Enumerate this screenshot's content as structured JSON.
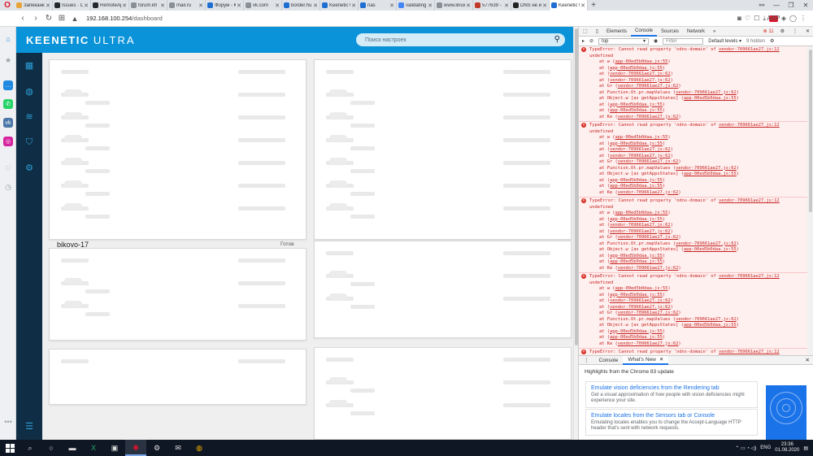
{
  "browser": {
    "logo": "O",
    "new_tab": "+",
    "close_glyph": "✕",
    "tabs": [
      {
        "label": "Запеканка",
        "color": "#e8a33b"
      },
      {
        "label": "Issues · Co",
        "color": "#24292e"
      },
      {
        "label": "RemoteAp",
        "color": "#24292e"
      },
      {
        "label": "forum.kh",
        "color": "#8a8f96"
      },
      {
        "label": "mail.ru",
        "color": "#8a8f96"
      },
      {
        "label": "Форум - К",
        "color": "#1f6fd0"
      },
      {
        "label": "vk.com",
        "color": "#8a8f96"
      },
      {
        "label": "border.hu",
        "color": "#1f6fd0"
      },
      {
        "label": "Keenetic U",
        "color": "#1f6fd0"
      },
      {
        "label": "nas",
        "color": "#1f6fd0"
      },
      {
        "label": "validating",
        "color": "#4285f4"
      },
      {
        "label": "www.linux",
        "color": "#8a8f96"
      },
      {
        "label": "577639 -",
        "color": "#c0392b"
      },
      {
        "label": "DNS не ис",
        "color": "#222222"
      },
      {
        "label": "Keenetic U",
        "color": "#1f6fd0",
        "active": true
      }
    ],
    "window_controls": [
      "⚯",
      "—",
      "❐",
      "✕"
    ],
    "url_host": "192.168.100.254",
    "url_path": "/dashboard",
    "sidebar_icons": [
      {
        "glyph": "⌂",
        "color": "#1f8ae0"
      },
      {
        "glyph": "★",
        "color": "#9aa0a6"
      },
      {
        "glyph": "…",
        "color": "#1f8ae0"
      },
      {
        "glyph": "✆",
        "color": "#25d366"
      },
      {
        "glyph": "vk",
        "color": "#4a76a8"
      },
      {
        "glyph": "◎",
        "color": "#d6249f"
      },
      {
        "glyph": "♡",
        "color": "#9aa0a6"
      },
      {
        "glyph": "◷",
        "color": "#9aa0a6"
      },
      {
        "glyph": "•••",
        "color": "#9aa0a6"
      }
    ]
  },
  "app": {
    "logo_main": "KEENETIC",
    "logo_sub": "ULTRA",
    "search_placeholder": "Поиск настроек",
    "node_name": "bikovo-17",
    "node_status": "Готов",
    "accent_color": "#0a93d8",
    "nav_bg": "#0f2e45"
  },
  "devtools": {
    "tabs": [
      "Elements",
      "Console",
      "Sources",
      "Network"
    ],
    "active_tab": "Console",
    "more_tabs": "»",
    "error_count": "11",
    "context": "top",
    "filter_placeholder": "Filter",
    "levels": "Default levels ▾",
    "hidden": "9 hidden",
    "errors": [
      {
        "message": "TypeError: Cannot read property 'ndns-domain' of",
        "source": "vendor-709661ae27.js:12",
        "message2": "undefined",
        "stack": [
          {
            "fn": "at w",
            "loc": "app-00ed5b0daa.js:55"
          },
          {
            "fn": "at",
            "loc": "app-00ed5b0daa.js:55"
          },
          {
            "fn": "at",
            "loc": "vendor-709661ae27.js:62"
          },
          {
            "fn": "at",
            "loc": "vendor-709661ae27.js:62"
          },
          {
            "fn": "at Gr",
            "loc": "vendor-709661ae27.js:62"
          },
          {
            "fn": "at Function.Ot.pr.mapValues",
            "loc": "vendor-709661ae27.js:62"
          },
          {
            "fn": "at Object.w [as getAppsStates]",
            "loc": "app-00ed5b0daa.js:55"
          },
          {
            "fn": "at",
            "loc": "app-00ed5b0daa.js:55"
          },
          {
            "fn": "at",
            "loc": "app-00ed5b0daa.js:55"
          },
          {
            "fn": "at Ke",
            "loc": "vendor-709661ae27.js:62"
          }
        ]
      },
      {
        "message": "TypeError: Cannot read property 'ndns-domain' of",
        "source": "vendor-709661ae27.js:12",
        "message2": "undefined",
        "stack": [
          {
            "fn": "at w",
            "loc": "app-00ed5b0daa.js:55"
          },
          {
            "fn": "at",
            "loc": "app-00ed5b0daa.js:55"
          },
          {
            "fn": "at",
            "loc": "vendor-709661ae27.js:62"
          },
          {
            "fn": "at",
            "loc": "vendor-709661ae27.js:62"
          },
          {
            "fn": "at Gr",
            "loc": "vendor-709661ae27.js:62"
          },
          {
            "fn": "at Function.Ot.pr.mapValues",
            "loc": "vendor-709661ae27.js:62"
          },
          {
            "fn": "at Object.w [as getAppsStates]",
            "loc": "app-00ed5b0daa.js:55"
          },
          {
            "fn": "at",
            "loc": "app-00ed5b0daa.js:55"
          },
          {
            "fn": "at",
            "loc": "app-00ed5b0daa.js:55"
          },
          {
            "fn": "at Ke",
            "loc": "vendor-709661ae27.js:62"
          }
        ]
      },
      {
        "message": "TypeError: Cannot read property 'ndns-domain' of",
        "source": "vendor-709661ae27.js:12",
        "message2": "undefined",
        "stack": [
          {
            "fn": "at w",
            "loc": "app-00ed5b0daa.js:55"
          },
          {
            "fn": "at",
            "loc": "app-00ed5b0daa.js:55"
          },
          {
            "fn": "at",
            "loc": "vendor-709661ae27.js:62"
          },
          {
            "fn": "at",
            "loc": "vendor-709661ae27.js:62"
          },
          {
            "fn": "at Gr",
            "loc": "vendor-709661ae27.js:62"
          },
          {
            "fn": "at Function.Ot.pr.mapValues",
            "loc": "vendor-709661ae27.js:62"
          },
          {
            "fn": "at Object.w [as getAppsStates]",
            "loc": "app-00ed5b0daa.js:55"
          },
          {
            "fn": "at",
            "loc": "app-00ed5b0daa.js:55"
          },
          {
            "fn": "at",
            "loc": "app-00ed5b0daa.js:55"
          },
          {
            "fn": "at Ke",
            "loc": "vendor-709661ae27.js:62"
          }
        ]
      },
      {
        "message": "TypeError: Cannot read property 'ndns-domain' of",
        "source": "vendor-709661ae27.js:12",
        "message2": "undefined",
        "stack": [
          {
            "fn": "at w",
            "loc": "app-00ed5b0daa.js:55"
          },
          {
            "fn": "at",
            "loc": "app-00ed5b0daa.js:55"
          },
          {
            "fn": "at",
            "loc": "vendor-709661ae27.js:62"
          },
          {
            "fn": "at",
            "loc": "vendor-709661ae27.js:62"
          },
          {
            "fn": "at Gr",
            "loc": "vendor-709661ae27.js:62"
          },
          {
            "fn": "at Function.Ot.pr.mapValues",
            "loc": "vendor-709661ae27.js:62"
          },
          {
            "fn": "at Object.w [as getAppsStates]",
            "loc": "app-00ed5b0daa.js:55"
          },
          {
            "fn": "at",
            "loc": "app-00ed5b0daa.js:55"
          },
          {
            "fn": "at",
            "loc": "app-00ed5b0daa.js:55"
          },
          {
            "fn": "at Ke",
            "loc": "vendor-709661ae27.js:62"
          }
        ]
      },
      {
        "message": "TypeError: Cannot read property 'ndns-domain' of",
        "source": "vendor-709661ae27.js:12",
        "message2": "",
        "stack": []
      }
    ],
    "drawer_tabs": [
      "Console",
      "What's New"
    ],
    "drawer_active": "What's New",
    "drawer_tab_close": "✕",
    "drawer_close": "✕",
    "highlights": "Highlights from the Chrome 83 update",
    "whats_new": [
      {
        "title": "Emulate vision deficiencies from the Rendering tab",
        "desc": "Get a visual approximation of how people with vision deficiencies might experience your site."
      },
      {
        "title": "Emulate locales from the Sensors tab or Console",
        "desc": "Emulating locales enables you to change the Accept-Language HTTP header that's sent with network requests."
      }
    ]
  },
  "taskbar": {
    "apps": [
      {
        "glyph": "⌕",
        "name": "search"
      },
      {
        "glyph": "○",
        "name": "task-view"
      },
      {
        "glyph": "▬",
        "name": "explorer"
      },
      {
        "glyph": "X",
        "name": "excel"
      },
      {
        "glyph": "▣",
        "name": "terminal"
      },
      {
        "glyph": "◉",
        "name": "opera"
      },
      {
        "glyph": "⚙",
        "name": "settings"
      },
      {
        "glyph": "✉",
        "name": "mail"
      },
      {
        "glyph": "◍",
        "name": "chrome"
      }
    ],
    "active_app": "opera",
    "tray_icons": "⌃ ▭ ◔ ◁)",
    "language": "ENG",
    "time": "23:36",
    "date": "01.08.2020"
  }
}
